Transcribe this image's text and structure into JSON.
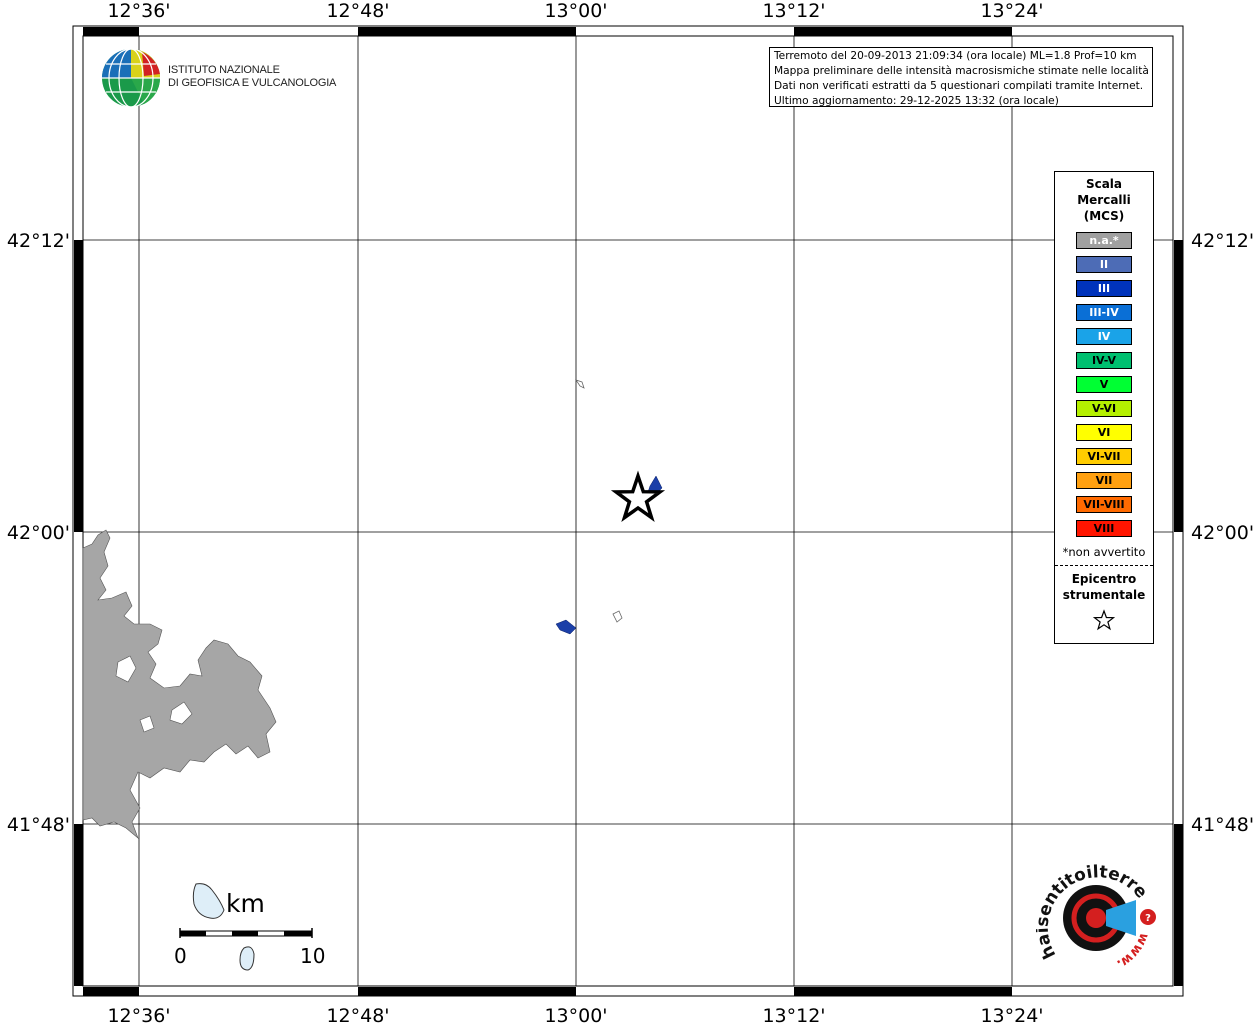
{
  "map": {
    "top_ticks": [
      "12°36'",
      "12°48'",
      "13°00'",
      "13°12'",
      "13°24'"
    ],
    "bottom_ticks": [
      "12°36'",
      "12°48'",
      "13°00'",
      "13°12'",
      "13°24'"
    ],
    "left_ticks": [
      "42°12'",
      "42°00'",
      "41°48'"
    ],
    "right_ticks": [
      "42°12'",
      "42°00'",
      "41°48'"
    ],
    "land_color": "#a6a6a6",
    "point_color": "#1b3fa8"
  },
  "info": {
    "line1": "Terremoto del 20-09-2013 21:09:34 (ora locale) ML=1.8 Prof=10 km",
    "line2": "Mappa preliminare delle intensità macrosismiche stimate nelle località",
    "line3": "Dati non verificati estratti da 5 questionari compilati tramite Internet.",
    "line4": "Ultimo aggiornamento: 29-12-2025 13:32 (ora locale)"
  },
  "logo": {
    "line1": "ISTITUTO NAZIONALE",
    "line2": "DI GEOFISICA E VULCANOLOGIA"
  },
  "legend": {
    "title1": "Scala",
    "title2": "Mercalli",
    "title3": "(MCS)",
    "items": [
      {
        "label": "n.a.*",
        "color": "#a0a0a0"
      },
      {
        "label": "II",
        "color": "#4d6cb6"
      },
      {
        "label": "III",
        "color": "#0033bb"
      },
      {
        "label": "III-IV",
        "color": "#0a6fd6"
      },
      {
        "label": "IV",
        "color": "#1aa3e8"
      },
      {
        "label": "IV-V",
        "color": "#00c070"
      },
      {
        "label": "V",
        "color": "#00ff33"
      },
      {
        "label": "V-VI",
        "color": "#b4f000"
      },
      {
        "label": "VI",
        "color": "#ffff00"
      },
      {
        "label": "VI-VII",
        "color": "#ffcc00"
      },
      {
        "label": "VII",
        "color": "#ffa010"
      },
      {
        "label": "VII-VIII",
        "color": "#ff6a00"
      },
      {
        "label": "VIII",
        "color": "#ff1500"
      }
    ],
    "note": "*non avvertito",
    "epi1": "Epicentro",
    "epi2": "strumentale"
  },
  "scalebar": {
    "unit": "km",
    "start": "0",
    "end": "10"
  },
  "hsit": {
    "text": "haisentitoilterremoto.it",
    "www": "www."
  }
}
